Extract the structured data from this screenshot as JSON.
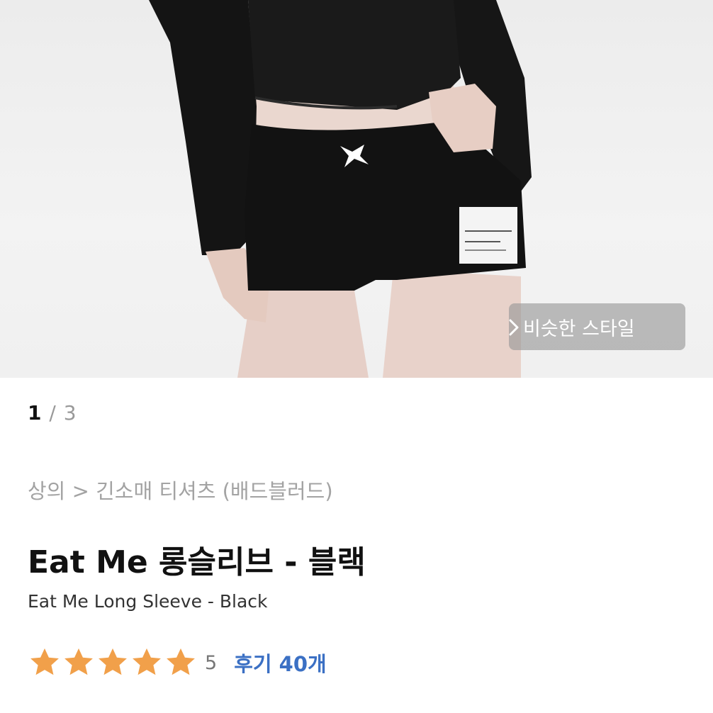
{
  "gallery": {
    "current": "1",
    "separator": "/",
    "total": "3"
  },
  "similar_style_button": {
    "label": "비슷한 스타일"
  },
  "breadcrumb": "상의 > 긴소매 티셔츠 (배드블러드)",
  "product": {
    "title": "Eat Me 롱슬리브 - 블랙",
    "subtitle": "Eat Me Long Sleeve - Black",
    "label_text": [
      "100% SURE",
      "BADBLOOD"
    ]
  },
  "rating": {
    "stars": 5,
    "score": "5",
    "reviews_label": "후기 40개"
  },
  "colors": {
    "star": "#f1a04a",
    "reviews": "#3b70c4",
    "title": "#111111"
  }
}
